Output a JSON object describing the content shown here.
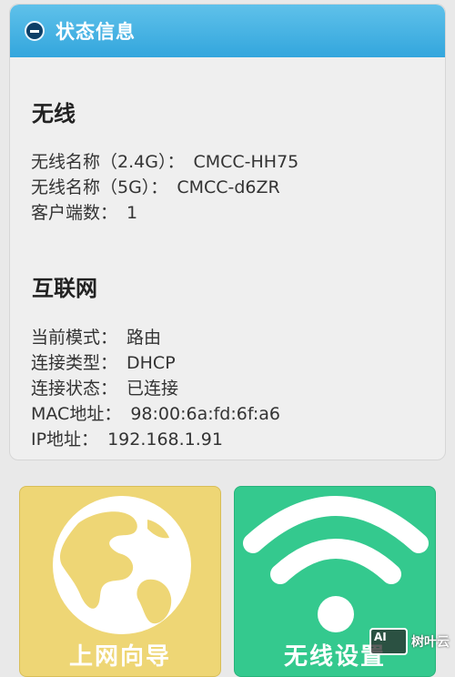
{
  "panel": {
    "title": "状态信息",
    "wireless": {
      "heading": "无线",
      "rows": [
        {
          "label": "无线名称（2.4G）：",
          "value": "CMCC-HH75"
        },
        {
          "label": "无线名称（5G）：",
          "value": "CMCC-d6ZR"
        },
        {
          "label": "客户端数：",
          "value": "1"
        }
      ]
    },
    "internet": {
      "heading": "互联网",
      "rows": [
        {
          "label": "当前模式：",
          "value": "路由"
        },
        {
          "label": "连接类型：",
          "value": "DHCP"
        },
        {
          "label": "连接状态：",
          "value": "已连接"
        },
        {
          "label": "MAC地址：",
          "value": "98:00:6a:fd:6f:a6"
        },
        {
          "label": "IP地址：",
          "value": "192.168.1.91"
        }
      ]
    }
  },
  "tiles": {
    "wizard": {
      "label": "上网向导",
      "icon": "globe-icon",
      "color": "#eed675"
    },
    "wifi": {
      "label": "无线设置",
      "icon": "wifi-icon",
      "color": "#34c98e"
    }
  },
  "watermark": {
    "logo_text": "AI",
    "text": "树叶云"
  },
  "colors": {
    "header": "#33a6dd",
    "accent_dark": "#0d3f67"
  }
}
